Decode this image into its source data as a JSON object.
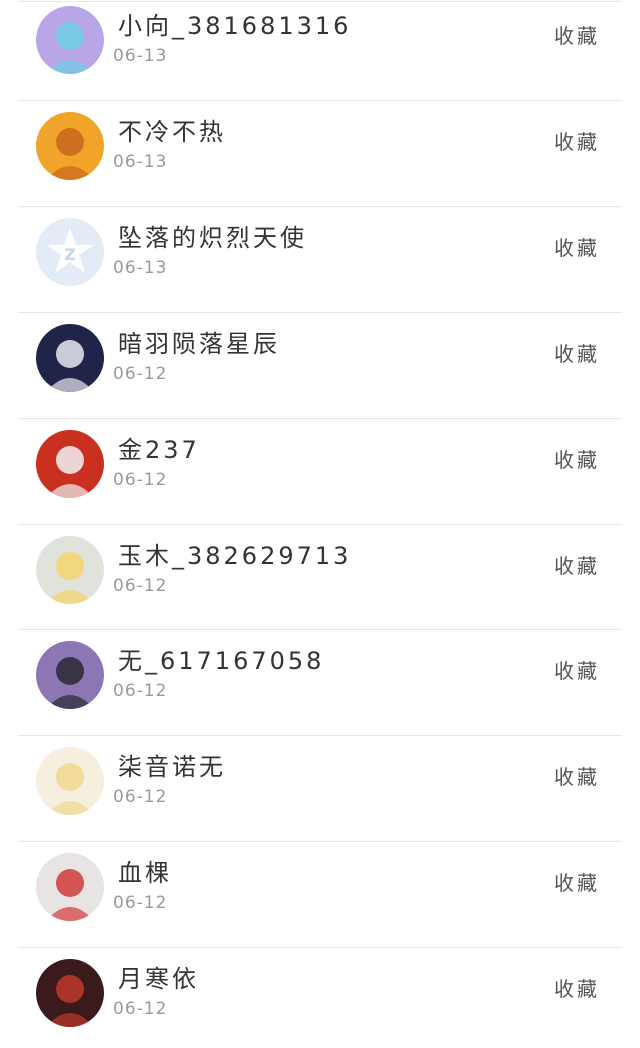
{
  "favorite_label": "收藏",
  "users": [
    {
      "name": "小向_381681316",
      "date": "06-13",
      "avatar": "anime-girl-pink-avatar",
      "bg": "#b9a6e8",
      "fg": "#6fd0e6"
    },
    {
      "name": "不冷不热",
      "date": "06-13",
      "avatar": "fawn-avatar",
      "bg": "#f0a52a",
      "fg": "#c8661d"
    },
    {
      "name": "坠落的炽烈天使",
      "date": "06-13",
      "avatar": "default-star-avatar",
      "bg": "#e3ecf6",
      "fg": "#ffffff"
    },
    {
      "name": "暗羽陨落星辰",
      "date": "06-12",
      "avatar": "dark-night-avatar",
      "bg": "#1f2448",
      "fg": "#e9e9f2"
    },
    {
      "name": "金237",
      "date": "06-12",
      "avatar": "anime-red-avatar",
      "bg": "#c9301f",
      "fg": "#f2f2f2"
    },
    {
      "name": "玉木_382629713",
      "date": "06-12",
      "avatar": "anime-white-hair-avatar",
      "bg": "#dfe3dc",
      "fg": "#f5d36a"
    },
    {
      "name": "无_617167058",
      "date": "06-12",
      "avatar": "ponytail-girl-avatar",
      "bg": "#8c76b4",
      "fg": "#2a2a33"
    },
    {
      "name": "柒音诺无",
      "date": "06-12",
      "avatar": "blonde-anime-avatar",
      "bg": "#f6efe0",
      "fg": "#f1d78e"
    },
    {
      "name": "血棵",
      "date": "06-12",
      "avatar": "white-hair-halo-avatar",
      "bg": "#e8e4e4",
      "fg": "#d03a3a"
    },
    {
      "name": "月寒依",
      "date": "06-12",
      "avatar": "dark-red-avatar",
      "bg": "#3a1a1a",
      "fg": "#c0392b"
    }
  ]
}
